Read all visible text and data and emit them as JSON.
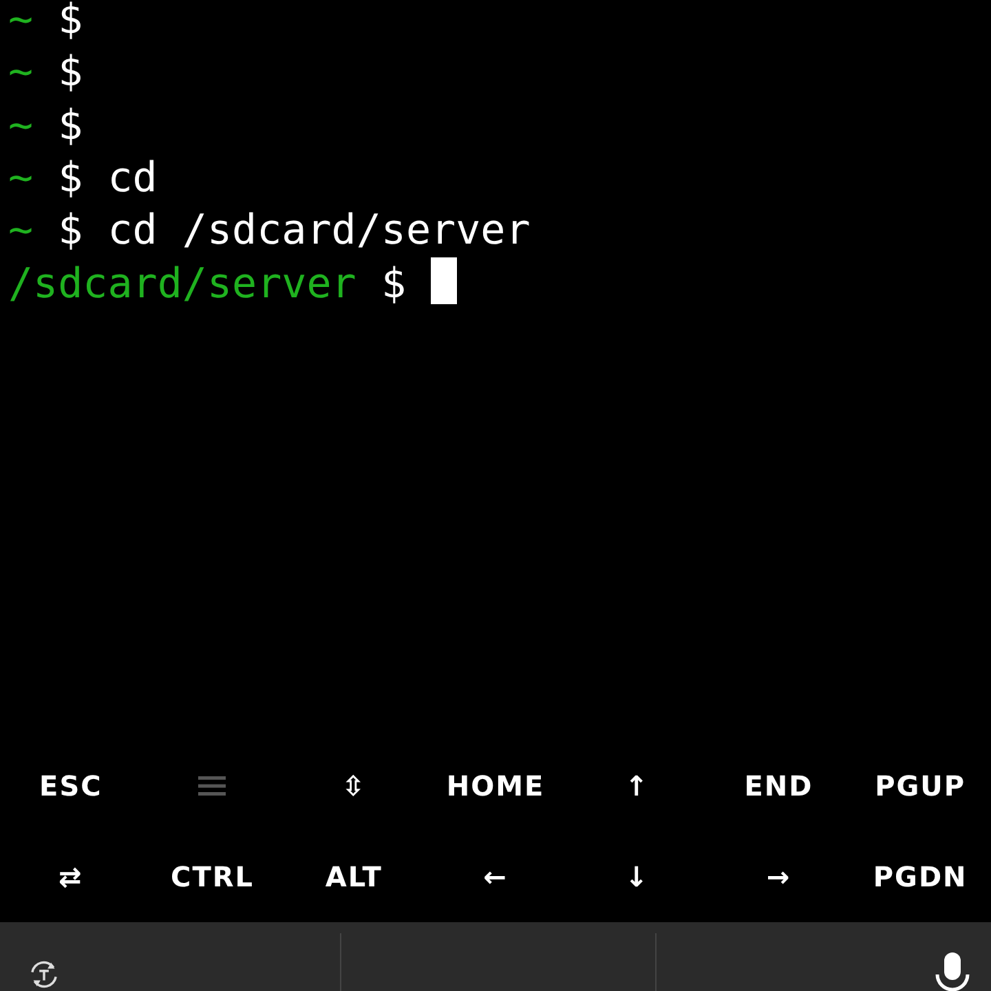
{
  "terminal": {
    "lines": [
      {
        "prompt": "~",
        "symbol": "$",
        "cursor": false
      },
      {
        "prompt": "~",
        "symbol": "$",
        "cursor": false
      },
      {
        "prompt": "~",
        "symbol": "$",
        "cursor": false
      },
      {
        "prompt": "~",
        "symbol": "$",
        "command": "cd",
        "cursor": false
      },
      {
        "prompt": "~",
        "symbol": "$",
        "command": "cd /sdcard/server",
        "cursor": false
      },
      {
        "prompt": "/sdcard/server",
        "symbol": "$",
        "cursor": true
      }
    ]
  },
  "extra_keys": [
    [
      {
        "kind": "text",
        "label": "ESC"
      },
      {
        "kind": "drawer"
      },
      {
        "kind": "text",
        "label": "⇳"
      },
      {
        "kind": "text",
        "label": "HOME"
      },
      {
        "kind": "text",
        "label": "↑"
      },
      {
        "kind": "text",
        "label": "END"
      },
      {
        "kind": "text",
        "label": "PGUP"
      }
    ],
    [
      {
        "kind": "text",
        "label": "⇄"
      },
      {
        "kind": "text",
        "label": "CTRL"
      },
      {
        "kind": "text",
        "label": "ALT"
      },
      {
        "kind": "text",
        "label": "←"
      },
      {
        "kind": "text",
        "label": "↓"
      },
      {
        "kind": "text",
        "label": "→"
      },
      {
        "kind": "text",
        "label": "PGDN"
      }
    ]
  ],
  "keyboard_bar": {
    "items": [
      {
        "kind": "theme"
      },
      {
        "kind": "blank"
      },
      {
        "kind": "mic"
      }
    ]
  }
}
